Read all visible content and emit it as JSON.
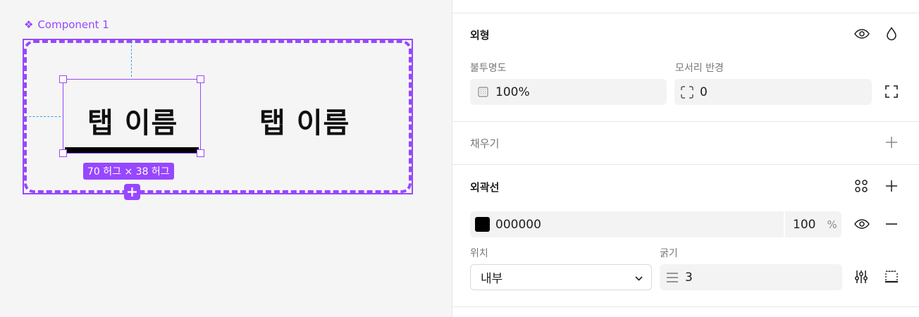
{
  "canvas": {
    "component_label": "Component 1",
    "tab_left_label": "탭 이름",
    "tab_right_label": "탭 이름",
    "size_badge": "70 허그 × 38 허그",
    "accent_color": "#9747ff",
    "guide_color": "#2fa3e6"
  },
  "panel": {
    "appearance": {
      "title": "외형",
      "opacity_label": "불투명도",
      "opacity_value": "100%",
      "radius_label": "모서리 반경",
      "radius_value": "0"
    },
    "fill": {
      "title": "채우기"
    },
    "stroke": {
      "title": "외곽선",
      "color_hex": "000000",
      "color_swatch": "#000000",
      "opacity_value": "100",
      "opacity_unit": "%",
      "position_label": "위치",
      "position_value": "내부",
      "weight_label": "굵기",
      "weight_value": "3"
    }
  },
  "icons": {
    "eye": "eye-icon",
    "drop": "drop-icon",
    "plus": "plus-icon",
    "minus": "minus-icon",
    "styles": "styles-grid-icon",
    "corners": "independent-corners-icon",
    "settings": "stroke-settings-icon",
    "sides": "stroke-sides-icon"
  }
}
